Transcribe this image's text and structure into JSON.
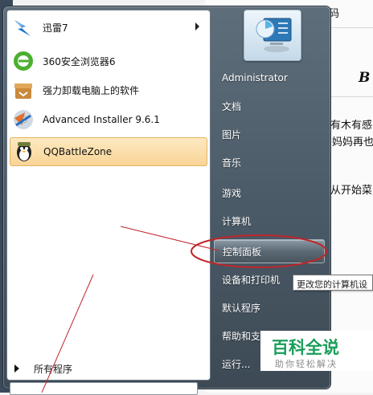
{
  "background_doc": {
    "top_fragment": "码",
    "bold_letter": "B",
    "fragment_1": "有木有感",
    "fragment_2": "妈妈再也",
    "fragment_3": "从开始菜"
  },
  "start_menu": {
    "pinned_programs": [
      {
        "label": "迅雷7",
        "icon": "thunder-icon",
        "has_submenu": true
      },
      {
        "label": "360安全浏览器6",
        "icon": "browser-360-icon",
        "has_submenu": false
      },
      {
        "label": "强力卸载电脑上的软件",
        "icon": "uninstall-box-icon",
        "has_submenu": false
      },
      {
        "label": "Advanced Installer 9.6.1",
        "icon": "advanced-installer-icon",
        "has_submenu": false
      },
      {
        "label": "QQBattleZone",
        "icon": "qq-penguin-icon",
        "has_submenu": false,
        "selected": true
      }
    ],
    "all_programs": "所有程序",
    "right_pane": {
      "user_picture": "user-picture-icon",
      "items": [
        {
          "label": "Administrator"
        },
        {
          "label": "文档"
        },
        {
          "label": "图片"
        },
        {
          "label": "音乐"
        },
        {
          "label": "游戏"
        },
        {
          "label": "计算机"
        },
        {
          "label": "控制面板",
          "highlighted": true
        },
        {
          "label": "设备和打印机"
        },
        {
          "label": "默认程序"
        },
        {
          "label": "帮助和支"
        },
        {
          "label": "运行..."
        }
      ]
    },
    "tooltip": "更改您的计算机设"
  },
  "watermark": {
    "title": "百科全说",
    "subtitle": "助你轻松解决"
  },
  "colors": {
    "annotation_red": "#c0262a",
    "watermark_green": "#1a9e5a",
    "selection_orange": "#f9d497"
  }
}
